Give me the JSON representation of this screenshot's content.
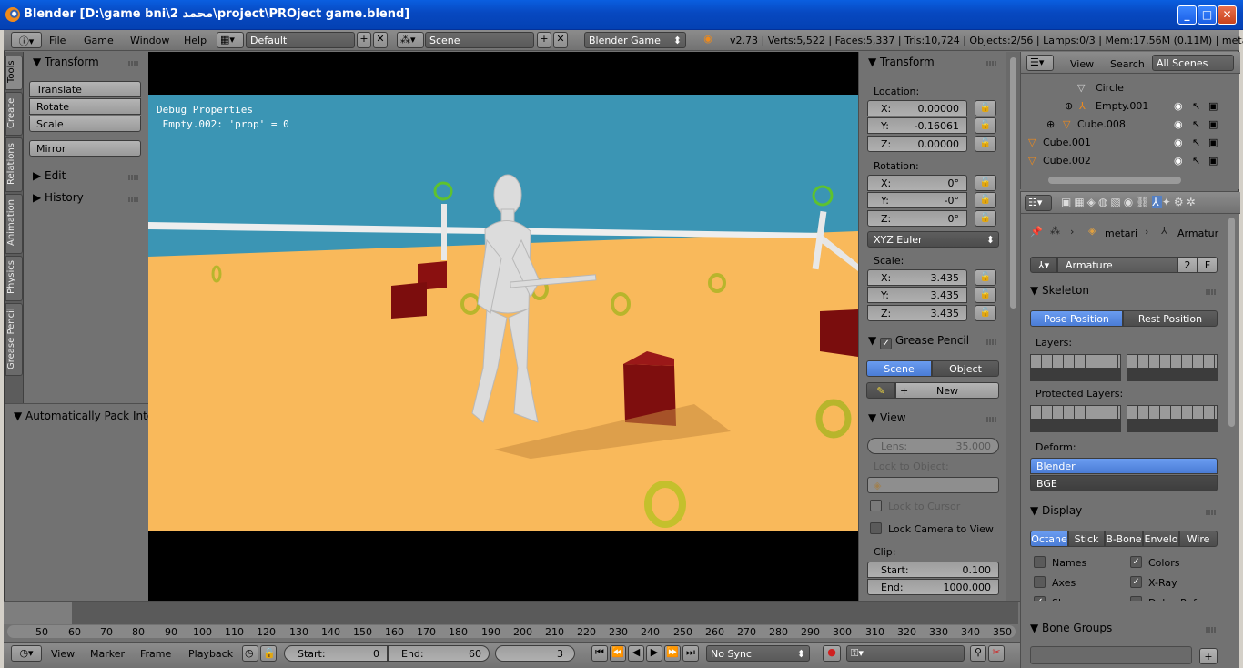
{
  "window": {
    "title": "Blender [D:\\game bni\\2 محمد\\project\\PROject game.blend]",
    "minimize": "_",
    "maximize": "□",
    "close": "✕"
  },
  "header": {
    "menus": [
      "File",
      "Game",
      "Window",
      "Help"
    ],
    "screen_layout": "Default",
    "scene": "Scene",
    "engine": "Blender Game",
    "stats": "v2.73 | Verts:5,522 | Faces:5,337 | Tris:10,724 | Objects:2/56 | Lamps:0/3 | Mem:17.56M (0.11M) | metarig"
  },
  "tool_tabs": [
    "Tools",
    "Create",
    "Relations",
    "Animation",
    "Physics",
    "Grease Pencil"
  ],
  "tool_shelf": {
    "transform_title": "Transform",
    "translate": "Translate",
    "rotate": "Rotate",
    "scale": "Scale",
    "mirror": "Mirror",
    "edit": "Edit",
    "history": "History"
  },
  "pack_panel": {
    "title": "Automatically Pack Into"
  },
  "viewport": {
    "debug_title": "Debug Properties",
    "debug_line": " Empty.002: 'prop' = 0"
  },
  "npanel": {
    "transform_title": "Transform",
    "location_label": "Location:",
    "location": [
      {
        "k": "X:",
        "v": "0.00000"
      },
      {
        "k": "Y:",
        "v": "-0.16061"
      },
      {
        "k": "Z:",
        "v": "0.00000"
      }
    ],
    "rotation_label": "Rotation:",
    "rotation": [
      {
        "k": "X:",
        "v": "0°"
      },
      {
        "k": "Y:",
        "v": "-0°"
      },
      {
        "k": "Z:",
        "v": "0°"
      }
    ],
    "rotation_mode": "XYZ Euler",
    "scale_label": "Scale:",
    "scale": [
      {
        "k": "X:",
        "v": "3.435"
      },
      {
        "k": "Y:",
        "v": "3.435"
      },
      {
        "k": "Z:",
        "v": "3.435"
      }
    ],
    "grease_pencil": "Grease Pencil",
    "gp_scene": "Scene",
    "gp_object": "Object",
    "gp_new": "New",
    "view_title": "View",
    "lens_label": "Lens:",
    "lens_value": "35.000",
    "lock_to_object": "Lock to Object:",
    "lock_to_cursor": "Lock to Cursor",
    "lock_camera": "Lock Camera to View",
    "clip_label": "Clip:",
    "clip_start_k": "Start:",
    "clip_start_v": "0.100",
    "clip_end_k": "End:",
    "clip_end_v": "1000.000"
  },
  "outliner": {
    "view": "View",
    "search": "Search",
    "all_scenes": "All Scenes",
    "rows": [
      "Circle",
      "Empty.001",
      "Cube.008",
      "Cube.001",
      "Cube.002"
    ]
  },
  "properties": {
    "breadcrumb_obj": "metari",
    "breadcrumb_arm": "Armatur",
    "datablock": "Armature",
    "users": "2",
    "fake": "F",
    "skeleton_title": "Skeleton",
    "pose_position": "Pose Position",
    "rest_position": "Rest Position",
    "layers_label": "Layers:",
    "protected_label": "Protected Layers:",
    "deform_label": "Deform:",
    "deform_blender": "Blender",
    "deform_bge": "BGE",
    "display_title": "Display",
    "display_types": [
      "Octahe",
      "Stick",
      "B-Bone",
      "Envelo",
      "Wire"
    ],
    "names": "Names",
    "colors": "Colors",
    "axes": "Axes",
    "xray": "X-Ray",
    "shapes": "Shapes",
    "delay": "Delay Refre...",
    "bone_groups": "Bone Groups"
  },
  "timeline": {
    "ticks": [
      "50",
      "60",
      "70",
      "80",
      "90",
      "100",
      "110",
      "120",
      "130",
      "140",
      "150",
      "160",
      "170",
      "180",
      "190",
      "200",
      "210",
      "220",
      "230",
      "240",
      "250",
      "260",
      "270",
      "280",
      "290",
      "300",
      "310",
      "320",
      "330",
      "340",
      "350"
    ],
    "menus": [
      "View",
      "Marker",
      "Frame",
      "Playback"
    ],
    "start_k": "Start:",
    "start_v": "0",
    "end_k": "End:",
    "end_v": "60",
    "current": "3",
    "sync": "No Sync"
  },
  "colors": {
    "accent": "#5680c2",
    "panel": "#727272",
    "sky": "#3b95b4",
    "floor": "#f9b95b",
    "cube": "#8a1010"
  }
}
